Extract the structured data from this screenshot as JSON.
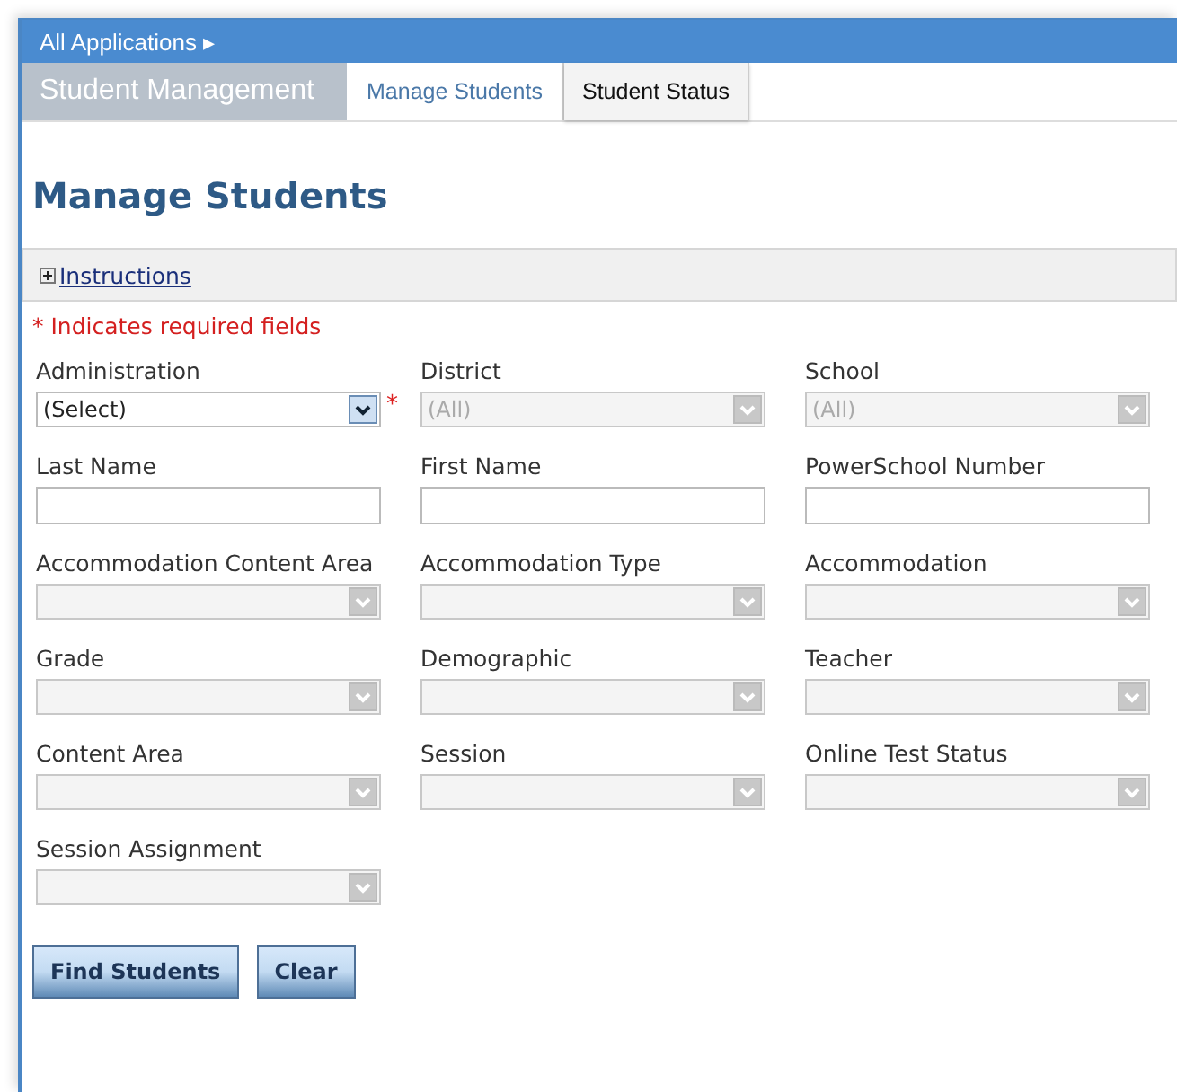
{
  "breadcrumb": {
    "label": "All Applications",
    "arrow": "▸"
  },
  "app_title": "Student Management",
  "tabs": [
    {
      "label": "Manage Students",
      "selected": true
    },
    {
      "label": "Student Status",
      "selected": false
    }
  ],
  "heading": "Manage Students",
  "instructions": {
    "label": "Instructions",
    "expanded": false
  },
  "required_note": "* Indicates required fields",
  "fields": [
    {
      "label": "Administration",
      "kind": "select",
      "value": "(Select)",
      "disabled": false,
      "required": true,
      "required_mark": "*"
    },
    {
      "label": "District",
      "kind": "select",
      "value": "(All)",
      "disabled": true,
      "required": false
    },
    {
      "label": "School",
      "kind": "select",
      "value": "(All)",
      "disabled": true,
      "required": false
    },
    {
      "label": "Last Name",
      "kind": "text",
      "required": false
    },
    {
      "label": "First Name",
      "kind": "text",
      "required": false
    },
    {
      "label": "PowerSchool Number",
      "kind": "text",
      "required": false
    },
    {
      "label": "Accommodation Content Area",
      "kind": "select",
      "disabled": true,
      "required": false
    },
    {
      "label": "Accommodation Type",
      "kind": "select",
      "disabled": true,
      "required": false
    },
    {
      "label": "Accommodation",
      "kind": "select",
      "disabled": true,
      "required": false
    },
    {
      "label": "Grade",
      "kind": "select",
      "disabled": true,
      "required": false
    },
    {
      "label": "Demographic",
      "kind": "select",
      "disabled": true,
      "required": false
    },
    {
      "label": "Teacher",
      "kind": "select",
      "disabled": true,
      "required": false
    },
    {
      "label": "Content Area",
      "kind": "select",
      "disabled": true,
      "required": false
    },
    {
      "label": "Session",
      "kind": "select",
      "disabled": true,
      "required": false
    },
    {
      "label": "Online Test Status",
      "kind": "select",
      "disabled": true,
      "required": false
    },
    {
      "label": "Session Assignment",
      "kind": "select",
      "disabled": true,
      "required": false
    }
  ],
  "buttons": [
    "Find Students",
    "Clear"
  ]
}
